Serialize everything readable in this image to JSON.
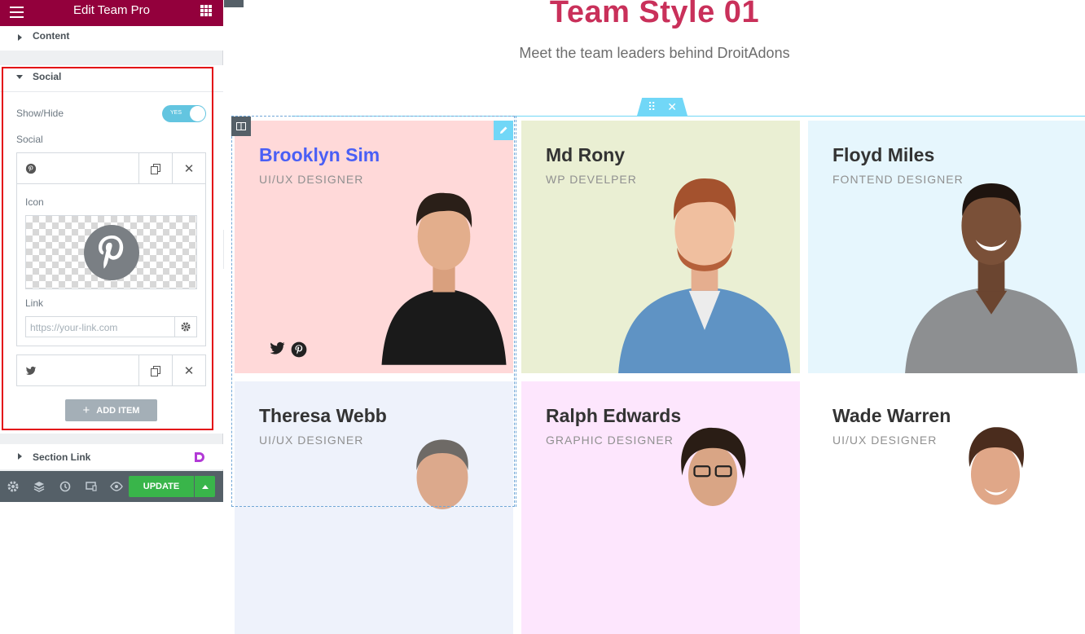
{
  "panel": {
    "title": "Edit Team Pro",
    "sections": {
      "content": "Content",
      "social": "Social",
      "section_link": "Section Link"
    },
    "show_hide": {
      "label": "Show/Hide",
      "state": "YES"
    },
    "social_label": "Social",
    "items": [
      {
        "icon": "pinterest-icon"
      },
      {
        "icon": "twitter-icon"
      }
    ],
    "icon_label": "Icon",
    "link_label": "Link",
    "link_placeholder": "https://your-link.com",
    "add_item": "ADD ITEM",
    "update": "UPDATE"
  },
  "page": {
    "title": "Team Style 01",
    "subtitle": "Meet the team leaders behind DroitAdons"
  },
  "team": [
    {
      "name": "Brooklyn Sim",
      "role": "UI/UX DESIGNER",
      "bg": "#ffd9d9",
      "name_color": "#4a5ff5"
    },
    {
      "name": "Md Rony",
      "role": "WP DEVELPER",
      "bg": "#eaefd3",
      "name_color": "#333333"
    },
    {
      "name": "Floyd Miles",
      "role": "FONTEND DESIGNER",
      "bg": "#e6f6fd",
      "name_color": "#333333"
    },
    {
      "name": "Theresa Webb",
      "role": "UI/UX DESIGNER",
      "bg": "#eef2fb",
      "name_color": "#333333"
    },
    {
      "name": "Ralph Edwards",
      "role": "GRAPHIC DESIGNER",
      "bg": "#fde6fd",
      "name_color": "#333333"
    },
    {
      "name": "Wade Warren",
      "role": "UI/UX DESIGNER",
      "bg": "#ffffff",
      "name_color": "#333333"
    }
  ],
  "colors": {
    "header": "#93003c",
    "title": "#c9305a",
    "accent": "#71d7f7",
    "update": "#39b54a",
    "highlight": "#e30613"
  }
}
